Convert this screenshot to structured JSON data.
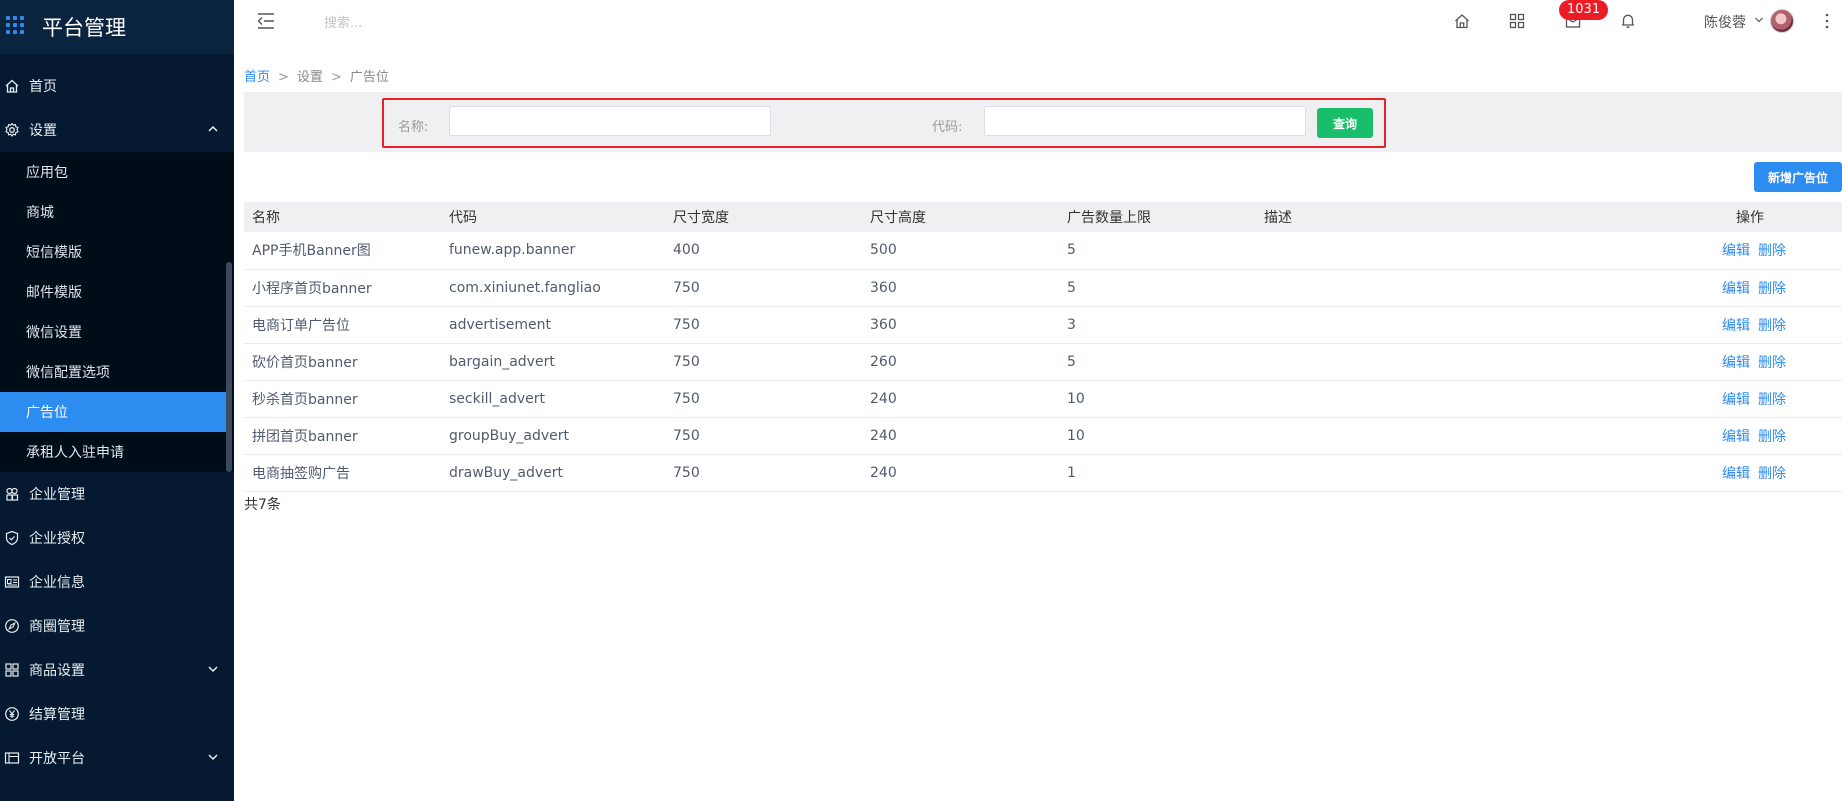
{
  "brand": {
    "title": "平台管理"
  },
  "sidebar": {
    "top_items": [
      {
        "label": "首页",
        "icon": "home-icon"
      }
    ],
    "settings": {
      "label": "设置",
      "icon": "gear-icon"
    },
    "sub_items": [
      {
        "label": "应用包"
      },
      {
        "label": "商城"
      },
      {
        "label": "短信模版"
      },
      {
        "label": "邮件模版"
      },
      {
        "label": "微信设置"
      },
      {
        "label": "微信配置选项"
      },
      {
        "label": "广告位",
        "active": true
      },
      {
        "label": "承租人入驻申请"
      }
    ],
    "bottom_items": [
      {
        "label": "企业管理",
        "icon": "cluster-icon"
      },
      {
        "label": "企业授权",
        "icon": "shield-icon"
      },
      {
        "label": "企业信息",
        "icon": "id-card-icon"
      },
      {
        "label": "商圈管理",
        "icon": "compass-icon"
      },
      {
        "label": "商品设置",
        "icon": "grid-icon",
        "expandable": true
      },
      {
        "label": "结算管理",
        "icon": "yen-icon"
      },
      {
        "label": "开放平台",
        "icon": "panel-icon",
        "expandable": true
      }
    ]
  },
  "header": {
    "search_placeholder": "搜索...",
    "badge_count": "1031",
    "username": "陈俊蓉"
  },
  "breadcrumb": {
    "home": "首页",
    "level1": "设置",
    "current": "广告位"
  },
  "filter": {
    "name_label": "名称:",
    "code_label": "代码:",
    "query_button": "查询"
  },
  "add_button": "新增广告位",
  "table": {
    "headers": [
      "名称",
      "代码",
      "尺寸宽度",
      "尺寸高度",
      "广告数量上限",
      "描述",
      "操作"
    ],
    "edit_label": "编辑",
    "delete_label": "删除",
    "rows": [
      {
        "name": "APP手机Banner图",
        "code": "funew.app.banner",
        "width": "400",
        "height": "500",
        "max": "5",
        "desc": ""
      },
      {
        "name": "小程序首页banner",
        "code": "com.xiniunet.fangliao",
        "width": "750",
        "height": "360",
        "max": "5",
        "desc": ""
      },
      {
        "name": "电商订单广告位",
        "code": "advertisement",
        "width": "750",
        "height": "360",
        "max": "3",
        "desc": ""
      },
      {
        "name": "砍价首页banner",
        "code": "bargain_advert",
        "width": "750",
        "height": "260",
        "max": "5",
        "desc": ""
      },
      {
        "name": "秒杀首页banner",
        "code": "seckill_advert",
        "width": "750",
        "height": "240",
        "max": "10",
        "desc": ""
      },
      {
        "name": "拼团首页banner",
        "code": "groupBuy_advert",
        "width": "750",
        "height": "240",
        "max": "10",
        "desc": ""
      },
      {
        "name": "电商抽签购广告",
        "code": "drawBuy_advert",
        "width": "750",
        "height": "240",
        "max": "1",
        "desc": ""
      }
    ]
  },
  "total_text": "共7条",
  "colors": {
    "sidebar_bg": "#051a31",
    "accent": "#2d8cf0",
    "query_green": "#19be6b",
    "badge_red": "#ed1c24"
  }
}
